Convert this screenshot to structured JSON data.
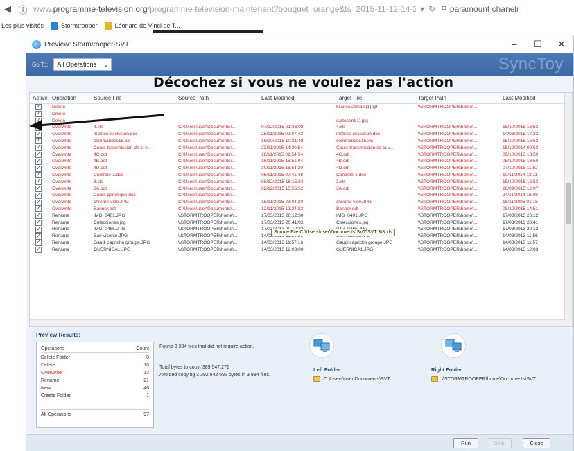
{
  "browser": {
    "url_prefix": "www.",
    "url_domain": "programme-television.org",
    "url_path": "/programme-television-maintenant?bouquet=orange&ts=2015-11-12-14-2#tous",
    "search_text": "paramount chanelr",
    "bookmarks": [
      "Les plus visités",
      "Stormtrooper",
      "Léonard de Vinci de T..."
    ]
  },
  "dialog": {
    "title": "Preview: Stormtrooper-SVT",
    "brand": "SyncToy",
    "goto_label": "Go To:",
    "goto_value": "All Operations"
  },
  "table": {
    "headers": [
      "Active",
      "Operation",
      "Source File",
      "Source Path",
      "Last Modified",
      "Target File",
      "Target Path",
      "Last Modified"
    ],
    "rows": [
      {
        "op": "Delete",
        "src": "",
        "spath": "",
        "mod": "",
        "tfile": "FranceClimats(1).gif",
        "tpath": "\\\\STORMTROOPER\\home\\...",
        "tmod": "",
        "style": "red"
      },
      {
        "op": "Delete",
        "src": "",
        "spath": "",
        "mod": "",
        "tfile": "",
        "tpath": "",
        "tmod": "",
        "style": "red"
      },
      {
        "op": "Delete",
        "src": "",
        "spath": "",
        "mod": "",
        "tfile": "cartecent(1).jpg",
        "tpath": "",
        "tmod": "",
        "style": "red"
      },
      {
        "op": "Overwrite",
        "src": "4.xls",
        "spath": "C:\\Users\\user\\Documents\\...",
        "mod": "07/12/2015 21:36:08",
        "tfile": "4.xls",
        "tpath": "\\\\STORMTROOPER\\home\\...",
        "tmod": "15/10/2015 16:53",
        "style": "red"
      },
      {
        "op": "Overwrite",
        "src": "matrice exclusion.doc",
        "spath": "C:\\Users\\user\\Documents\\...",
        "mod": "25/11/2015 09:07:42",
        "tfile": "matrice exclusion.doc",
        "tpath": "\\\\STORMTROOPER\\home\\...",
        "tmod": "14/06/2015 17:22",
        "style": "red"
      },
      {
        "op": "Overwrite",
        "src": "commandes15.xls",
        "spath": "C:\\Users\\user\\Documents\\...",
        "mod": "16/10/2015 10:21:48",
        "tfile": "commandes15.xls",
        "tpath": "\\\\STORMTROOPER\\home\\...",
        "tmod": "15/10/2015 16:53",
        "style": "red"
      },
      {
        "op": "Overwrite",
        "src": "Cours transmission de la v...",
        "spath": "C:\\Users\\user\\Documents\\...",
        "mod": "23/11/2015 14:30:54",
        "tfile": "Cours transmission de la v...",
        "tpath": "\\\\STORMTROOPER\\home\\...",
        "tmod": "15/12/2014 09:53",
        "style": "red"
      },
      {
        "op": "Overwrite",
        "src": "4C.odt",
        "spath": "C:\\Users\\user\\Documents\\...",
        "mod": "18/11/2015 09:54:54",
        "tfile": "4C.odt",
        "tpath": "\\\\STORMTROOPER\\home\\...",
        "tmod": "09/10/2015 13:59",
        "style": "red"
      },
      {
        "op": "Overwrite",
        "src": "4B.odt",
        "spath": "C:\\Users\\user\\Documents\\...",
        "mod": "16/11/2015 16:51:04",
        "tfile": "4B.odt",
        "tpath": "\\\\STORMTROOPER\\home\\...",
        "tmod": "05/10/2015 16:50",
        "style": "red"
      },
      {
        "op": "Overwrite",
        "src": "4D.odt",
        "spath": "C:\\Users\\user\\Documents\\...",
        "mod": "30/11/2015 16:54:20",
        "tfile": "4D.odt",
        "tpath": "\\\\STORMTROOPER\\home\\...",
        "tmod": "07/10/2015 11:52",
        "style": "red"
      },
      {
        "op": "Overwrite",
        "src": "Controle-1.doc",
        "spath": "C:\\Users\\user\\Documents\\...",
        "mod": "06/11/2015 07:41:48",
        "tfile": "Controle-1.doc",
        "tpath": "\\\\STORMTROOPER\\home\\...",
        "tmod": "10/11/2014 13:11",
        "style": "red"
      },
      {
        "op": "Overwrite",
        "src": "3.xls",
        "spath": "C:\\Users\\user\\Documents\\...",
        "mod": "08/12/2015 16:15:34",
        "tfile": "3.xls",
        "tpath": "\\\\STORMTROOPER\\home\\...",
        "tmod": "15/10/2015 16:53",
        "style": "red"
      },
      {
        "op": "Overwrite",
        "src": "3A.odt",
        "spath": "C:\\Users\\user\\Documents\\...",
        "mod": "02/12/2015 15:55:52",
        "tfile": "3A.odt",
        "tpath": "\\\\STORMTROOPER\\home\\...",
        "tmod": "28/09/2015 12:07",
        "style": "red"
      },
      {
        "op": "Overwrite",
        "src": "Cours genetique.doc",
        "spath": "C:\\Users\\user\\Documents\\...",
        "mod": "",
        "tfile": "",
        "tpath": "\\\\STORMTROOPER\\home\\...",
        "tmod": "24/11/2014 16:08",
        "style": "red"
      },
      {
        "op": "Overwrite",
        "src": "chromo-vide.JPG",
        "spath": "C:\\Users\\user\\Documents\\...",
        "mod": "15/11/2015 23:04:20",
        "tfile": "chromo-vide.JPG",
        "tpath": "\\\\STORMTROOPER\\home\\...",
        "tmod": "16/11/2006 01:15",
        "style": "red"
      },
      {
        "op": "Overwrite",
        "src": "Banner.odt",
        "spath": "C:\\Users\\user\\Documents\\...",
        "mod": "12/11/2015 12:24:22",
        "tfile": "Banner.odt",
        "tpath": "\\\\STORMTROOPER\\home\\...",
        "tmod": "08/10/2015 14:51",
        "style": "red"
      },
      {
        "op": "Rename",
        "src": "IMG_0401.JPG",
        "spath": "\\\\STORMTROOPER\\home\\...",
        "mod": "17/03/2013 20:12:30",
        "tfile": "IMG_0401.JPG",
        "tpath": "\\\\STORMTROOPER\\home\\...",
        "tmod": "17/03/2013 20:12",
        "style": "dark"
      },
      {
        "op": "Rename",
        "src": "Colecciones.jpg",
        "spath": "\\\\STORMTROOPER\\home\\...",
        "mod": "17/03/2013 20:41:02",
        "tfile": "Colecciones.jpg",
        "tpath": "\\\\STORMTROOPER\\home\\...",
        "tmod": "17/03/2013 20:41",
        "style": "dark"
      },
      {
        "op": "Rename",
        "src": "IMG_0465.JPG",
        "spath": "\\\\STORMTROOPER\\home\\...",
        "mod": "17/03/2013 20:12:32",
        "tfile": "IMG_0465.JPG",
        "tpath": "\\\\STORMTROOPER\\home\\...",
        "tmod": "17/03/2013 20:12",
        "style": "dark"
      },
      {
        "op": "Rename",
        "src": "San vicente.JPG",
        "spath": "\\\\STORMTROOPER\\home\\...",
        "mod": "14/03/2013 11:56:56",
        "tfile": "San vicente.JPG",
        "tpath": "\\\\STORMTROOPER\\home\\...",
        "tmod": "14/03/2013 11:56",
        "style": "dark"
      },
      {
        "op": "Rename",
        "src": "Gaudi capricho groupe.JPG",
        "spath": "\\\\STORMTROOPER\\home\\...",
        "mod": "14/03/2013 11:57:16",
        "tfile": "Gaudi capricho groupe.JPG",
        "tpath": "\\\\STORMTROOPER\\home\\...",
        "tmod": "14/03/2013 11:57",
        "style": "dark"
      },
      {
        "op": "Rename",
        "src": "GUERNICA1.JPG",
        "spath": "\\\\STORMTROOPER\\home\\...",
        "mod": "14/03/2013 12:03:00",
        "tfile": "GUERNICA1.JPG",
        "tpath": "\\\\STORMTROOPER\\home\\...",
        "tmod": "14/03/2013 12:03",
        "style": "dark"
      }
    ],
    "tooltip": "Source File:C:\\Users\\user\\Documents\\SVT\\SVT 3\\3.xls"
  },
  "annotation": "Décochez si vous ne voulez pas l'action",
  "results": {
    "title": "Preview Results:",
    "counts_header": [
      "Operations",
      "Count"
    ],
    "counts": [
      {
        "label": "Delete Folder",
        "value": "0",
        "style": "normal"
      },
      {
        "label": "Delete",
        "value": "16",
        "style": "red"
      },
      {
        "label": "Overwrite",
        "value": "13",
        "style": "red"
      },
      {
        "label": "Rename",
        "value": "21",
        "style": "normal"
      },
      {
        "label": "New",
        "value": "46",
        "style": "normal"
      },
      {
        "label": "Create Folder",
        "value": "1",
        "style": "normal"
      }
    ],
    "total": {
      "label": "All Operations",
      "value": "97"
    },
    "found_text": "Found 3 934 files that did not require action.",
    "bytes_text": "Total bytes to copy: 389,547,271",
    "avoided_text": "Avoided copying 3 392 642 692 bytes in 3 934 files.",
    "left_folder_title": "Left Folder",
    "left_folder_path": "C:\\Users\\user\\Documents\\SVT",
    "right_folder_title": "Right Folder",
    "right_folder_path": "\\\\STORMTROOPER\\home\\Documents\\SVT"
  },
  "footer": {
    "run": "Run",
    "stop": "Stop",
    "close": "Close"
  },
  "colors": {
    "accent": "#3d68a6",
    "delete_red": "#d42a2a"
  }
}
